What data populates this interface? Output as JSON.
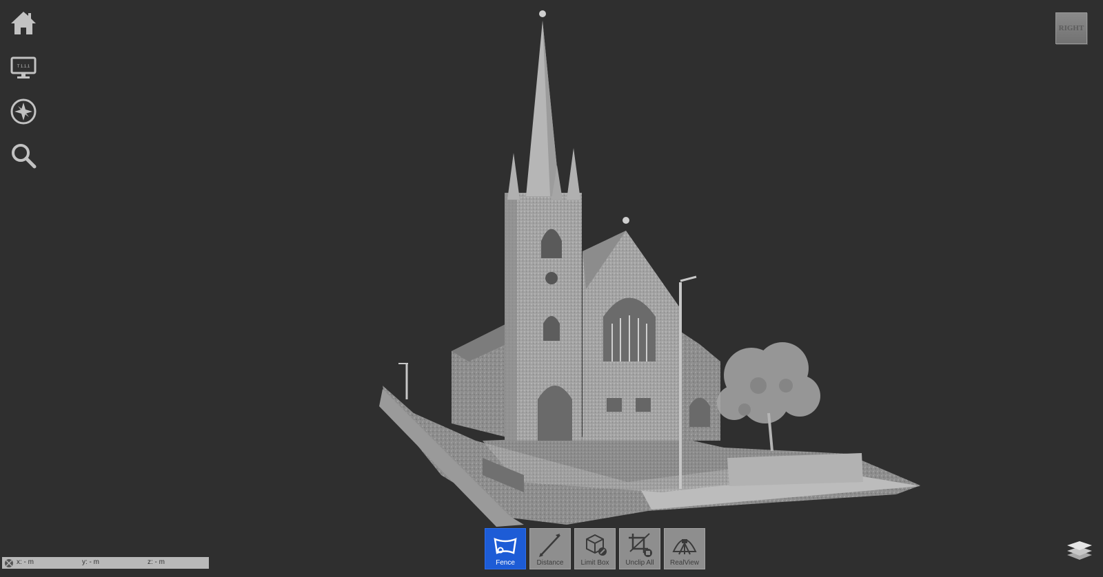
{
  "left_toolbar": {
    "home_icon": "home-icon",
    "display_icon": "monitor-icon",
    "display_icon_text": "T 1.1.1",
    "navigation_icon": "compass-icon",
    "search_icon": "magnifier-icon"
  },
  "viewcube": {
    "label": "RIGHT"
  },
  "toolbar": {
    "active_color": "#1d5cd6",
    "tools": [
      {
        "label": "Fence",
        "icon": "fence-icon",
        "active": true
      },
      {
        "label": "Distance",
        "icon": "distance-icon",
        "active": false
      },
      {
        "label": "Limit Box",
        "icon": "limit-box-icon",
        "active": false
      },
      {
        "label": "Unclip All",
        "icon": "unclip-all-icon",
        "active": false
      },
      {
        "label": "RealView",
        "icon": "realview-icon",
        "active": false
      }
    ]
  },
  "coordinates": {
    "x": "x:  -  m",
    "y": "y:  -  m",
    "z": "z:  -  m"
  },
  "layers_icon": "layers-icon",
  "background_color": "#2f2f2f"
}
